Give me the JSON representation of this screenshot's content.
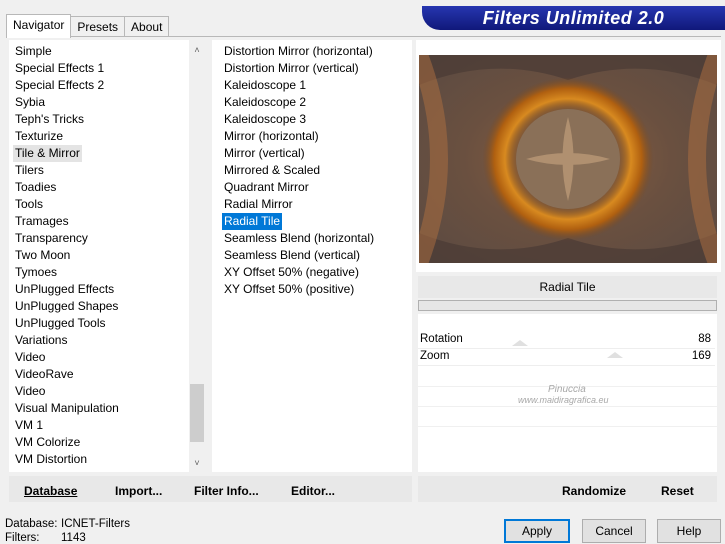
{
  "banner": "Filters Unlimited 2.0",
  "tabs": [
    {
      "label": "Navigator"
    },
    {
      "label": "Presets"
    },
    {
      "label": "About"
    }
  ],
  "categories": [
    "Simple",
    "Special Effects 1",
    "Special Effects 2",
    "Sybia",
    "Teph's Tricks",
    "Texturize",
    "Tile & Mirror",
    "Tilers",
    "Toadies",
    "Tools",
    "Tramages",
    "Transparency",
    "Two Moon",
    "Tymoes",
    "UnPlugged Effects",
    "UnPlugged Shapes",
    "UnPlugged Tools",
    "Variations",
    "Video",
    "VideoRave",
    "Video",
    "Visual Manipulation",
    "VM 1",
    "VM Colorize",
    "VM Distortion"
  ],
  "selected_category": "Tile & Mirror",
  "filters": [
    "Distortion Mirror (horizontal)",
    "Distortion Mirror (vertical)",
    "Kaleidoscope 1",
    "Kaleidoscope 2",
    "Kaleidoscope 3",
    "Mirror (horizontal)",
    "Mirror (vertical)",
    "Mirrored & Scaled",
    "Quadrant Mirror",
    "Radial Mirror",
    "Radial Tile",
    "Seamless Blend (horizontal)",
    "Seamless Blend (vertical)",
    "XY Offset 50% (negative)",
    "XY Offset 50% (positive)"
  ],
  "selected_filter": "Radial Tile",
  "filter_title": "Radial Tile",
  "params": [
    {
      "label": "Rotation",
      "value": "88",
      "level": 0.345
    },
    {
      "label": "Zoom",
      "value": "169",
      "level": 0.663
    }
  ],
  "watermark": {
    "line1": "Pinuccia",
    "line2": "www.maidiragrafica.eu"
  },
  "left_buttons": {
    "database": "Database",
    "import": "Import...",
    "filter_info": "Filter Info...",
    "editor": "Editor..."
  },
  "right_buttons": {
    "randomize": "Randomize",
    "reset": "Reset"
  },
  "status": {
    "db_label": "Database:",
    "db_value": "ICNET-Filters",
    "filters_label": "Filters:",
    "filters_value": "1143"
  },
  "dialog_buttons": {
    "apply": "Apply",
    "cancel": "Cancel",
    "help": "Help"
  },
  "colors": {
    "selection": "#0078d7",
    "banner": "#1a24a0"
  }
}
